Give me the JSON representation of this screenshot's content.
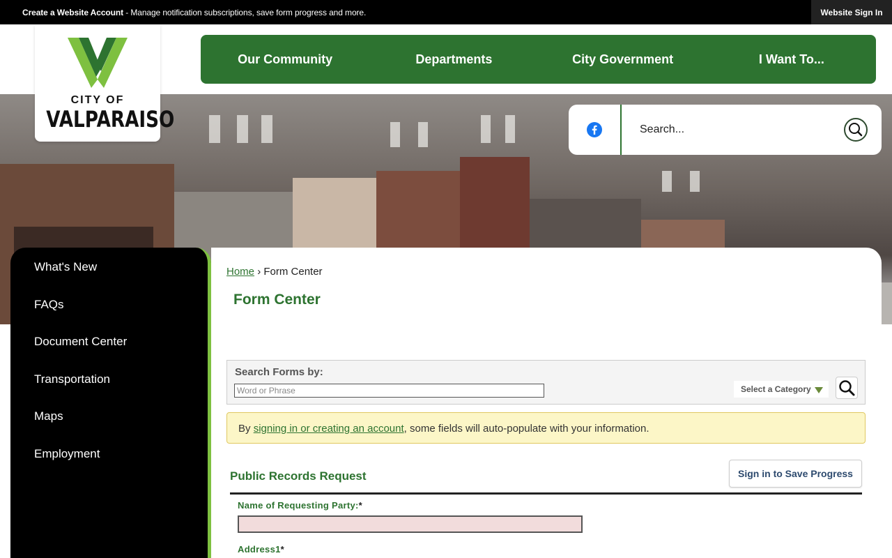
{
  "topbar": {
    "account_bold": "Create a Website Account",
    "account_rest": " - Manage notification subscriptions, save form progress and more.",
    "signin_label": "Website Sign In"
  },
  "logo": {
    "line1": "CITY OF",
    "line2": "VALPARAISO",
    "colors": {
      "dark_green": "#2d7330",
      "light_green": "#7ec040"
    }
  },
  "mainnav": {
    "items": [
      {
        "label": "Our Community"
      },
      {
        "label": "Departments"
      },
      {
        "label": "City Government"
      },
      {
        "label": "I Want To..."
      }
    ]
  },
  "search": {
    "placeholder": "Search...",
    "facebook_icon": "facebook-icon",
    "search_icon": "search-icon"
  },
  "sidenav": {
    "items": [
      {
        "label": "What's New"
      },
      {
        "label": "FAQs"
      },
      {
        "label": "Document Center"
      },
      {
        "label": "Transportation"
      },
      {
        "label": "Maps"
      },
      {
        "label": "Employment"
      }
    ]
  },
  "breadcrumb": {
    "home": "Home",
    "separator": "›",
    "current": "Form Center"
  },
  "page_title": "Form Center",
  "search_forms": {
    "label": "Search Forms by:",
    "placeholder": "Word or Phrase",
    "category_label": "Select a Category"
  },
  "notice": {
    "prefix": "By ",
    "link": "signing in or creating an account",
    "suffix": ", some fields will auto-populate with your information."
  },
  "form": {
    "title": "Public Records Request",
    "save_label": "Sign in to Save Progress",
    "fields": [
      {
        "label": "Name of Requesting Party:",
        "required": "*"
      },
      {
        "label": "Address1",
        "required": "*"
      }
    ]
  },
  "colors": {
    "brand_green": "#2d7330",
    "accent_green": "#7ec040",
    "notice_bg": "#fcf6c7",
    "required_field_bg": "#f2dcdc"
  }
}
